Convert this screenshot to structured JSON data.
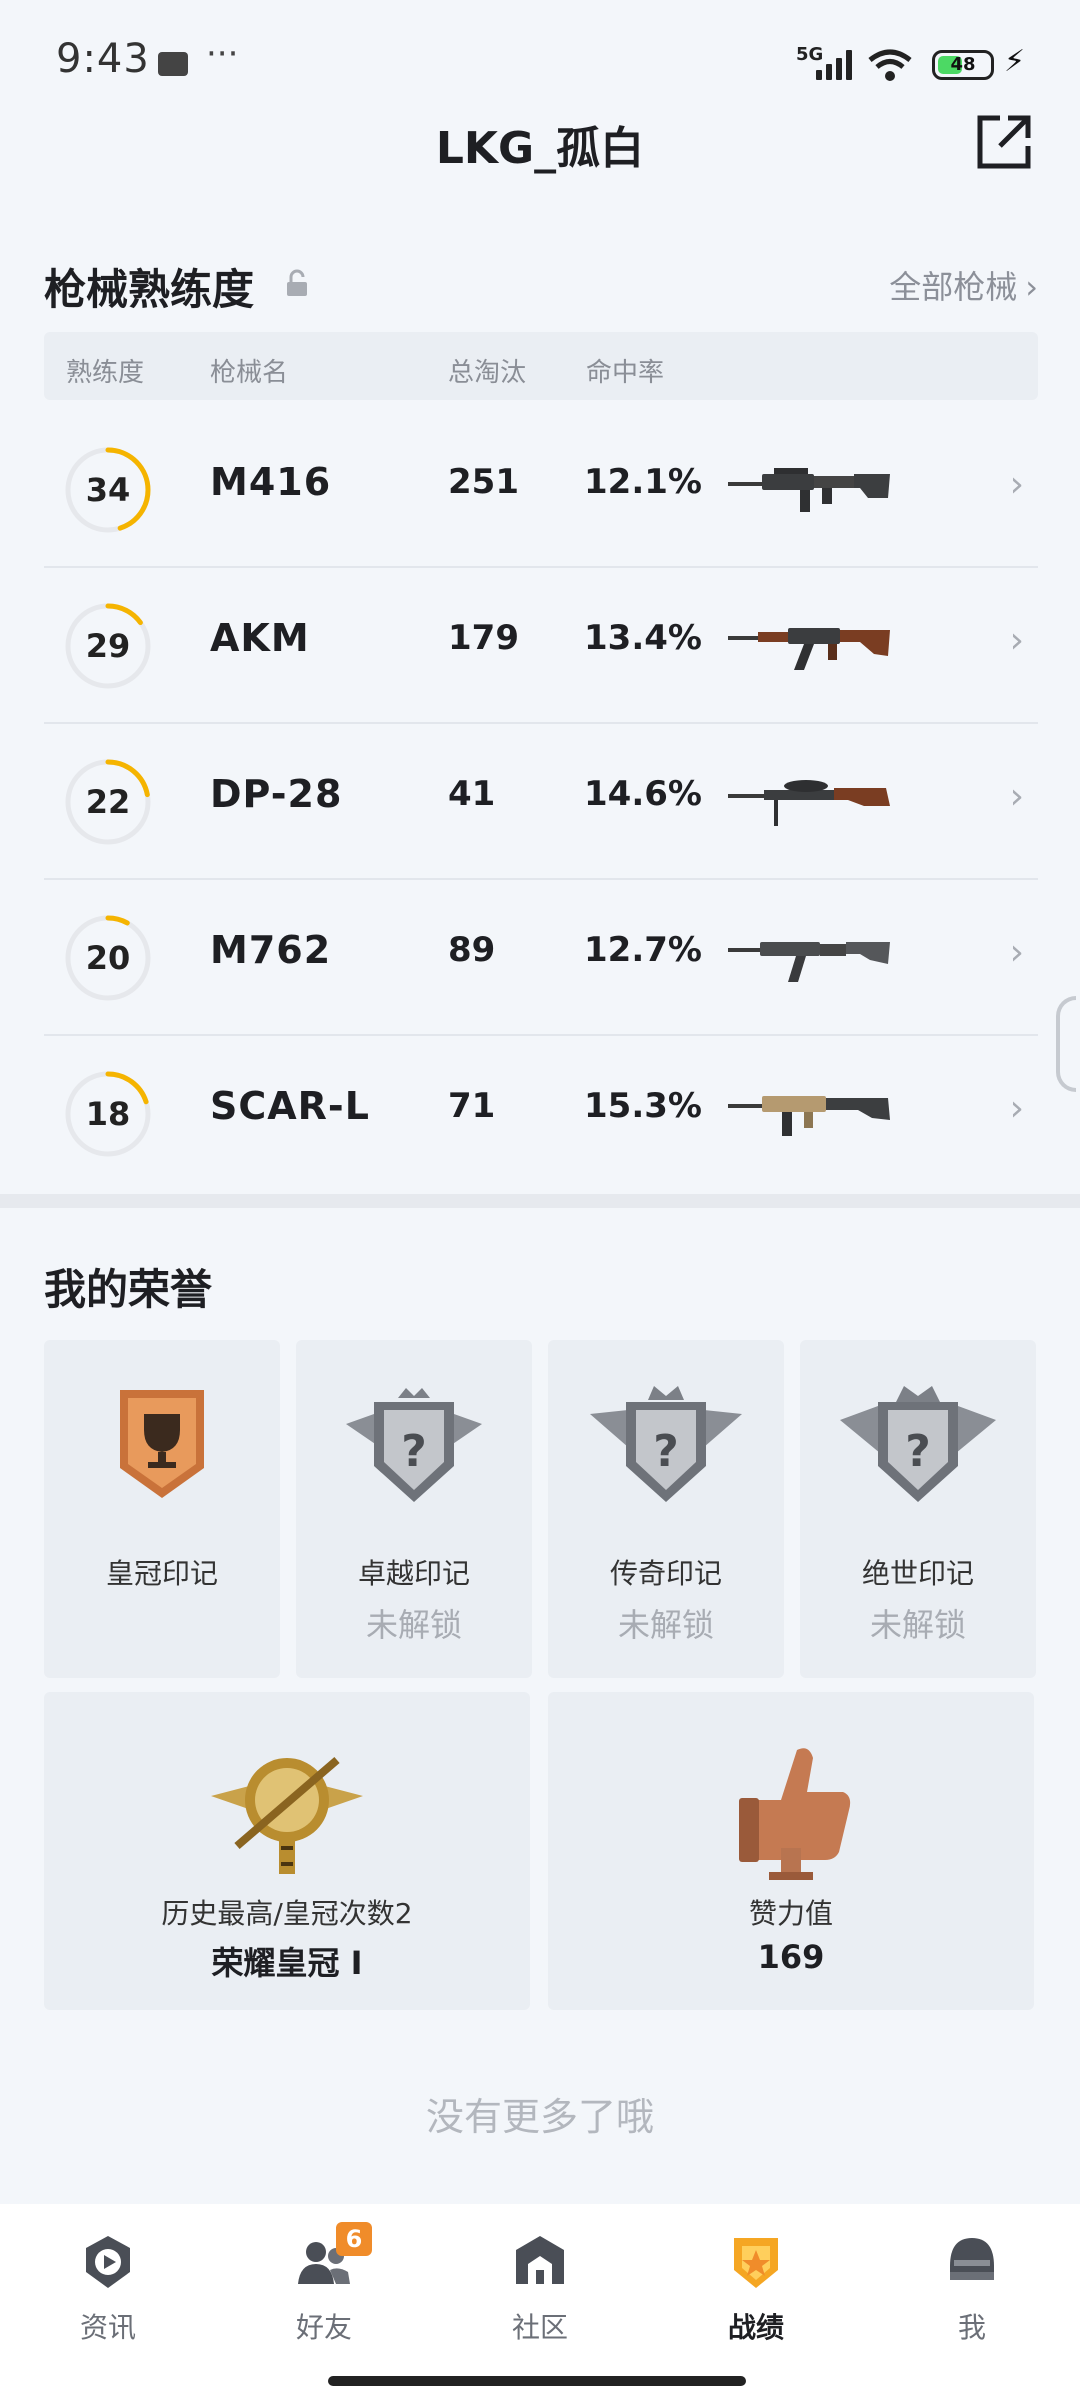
{
  "status_bar": {
    "time": "9:43",
    "dots": "···",
    "network": "5G",
    "battery": "48",
    "bolt": "⚡"
  },
  "header": {
    "title": "LKG_孤白"
  },
  "weapons": {
    "title": "枪械熟练度",
    "all_label": "全部枪械",
    "chevron": "›",
    "columns": [
      "熟练度",
      "枪械名",
      "总淘汰",
      "命中率"
    ],
    "rows": [
      {
        "level": "34",
        "name": "M416",
        "kills": "251",
        "accuracy": "12.1%",
        "progress": 0.45
      },
      {
        "level": "29",
        "name": "AKM",
        "kills": "179",
        "accuracy": "13.4%",
        "progress": 0.15
      },
      {
        "level": "22",
        "name": "DP-28",
        "kills": "41",
        "accuracy": "14.6%",
        "progress": 0.22
      },
      {
        "level": "20",
        "name": "M762",
        "kills": "89",
        "accuracy": "12.7%",
        "progress": 0.08
      },
      {
        "level": "18",
        "name": "SCAR-L",
        "kills": "71",
        "accuracy": "15.3%",
        "progress": 0.2
      }
    ]
  },
  "honors": {
    "title": "我的荣誉",
    "cards": [
      {
        "label": "皇冠印记",
        "status": ""
      },
      {
        "label": "卓越印记",
        "status": "未解锁"
      },
      {
        "label": "传奇印记",
        "status": "未解锁"
      },
      {
        "label": "绝世印记",
        "status": "未解锁"
      }
    ],
    "wide": [
      {
        "label": "历史最高/皇冠次数2",
        "value": "荣耀皇冠 Ⅰ"
      },
      {
        "label": "赞力值",
        "value": "169"
      }
    ]
  },
  "footer_text": "没有更多了哦",
  "nav": {
    "items": [
      {
        "label": "资讯",
        "icon": "news-icon"
      },
      {
        "label": "好友",
        "icon": "friends-icon",
        "badge": "6"
      },
      {
        "label": "社区",
        "icon": "community-icon"
      },
      {
        "label": "战绩",
        "icon": "record-icon",
        "active": true
      },
      {
        "label": "我",
        "icon": "profile-icon"
      }
    ]
  },
  "colors": {
    "ring_progress": "#f5b400",
    "ring_track": "#e6e8ec",
    "accent_orange": "#f08c2a",
    "record_active": "#f5a623"
  }
}
